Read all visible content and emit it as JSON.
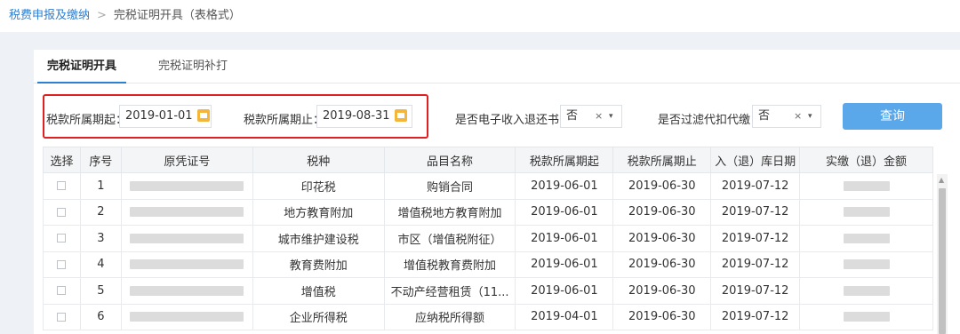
{
  "breadcrumb": {
    "parent": "税费申报及缴纳",
    "separator": ">",
    "current": "完税证明开具（表格式）"
  },
  "tabs": [
    {
      "label": "完税证明开具",
      "active": true
    },
    {
      "label": "完税证明补打",
      "active": false
    }
  ],
  "filters": {
    "start_label": "税款所属期起：",
    "start_value": "2019-01-01",
    "end_label": "税款所属期止：",
    "end_value": "2019-08-31",
    "refund_label": "是否电子收入退还书：",
    "refund_value": "否",
    "withhold_label": "是否过滤代扣代缴：",
    "withhold_value": "否",
    "clear_icon": "×",
    "caret_icon": "▾"
  },
  "query_button": "查询",
  "table": {
    "headers": [
      "选择",
      "序号",
      "原凭证号",
      "税种",
      "品目名称",
      "税款所属期起",
      "税款所属期止",
      "入（退）库日期",
      "实缴（退）金额"
    ],
    "rows": [
      {
        "no": "1",
        "tax": "印花税",
        "item": "购销合同",
        "start": "2019-06-01",
        "end": "2019-06-30",
        "date": "2019-07-12"
      },
      {
        "no": "2",
        "tax": "地方教育附加",
        "item": "增值税地方教育附加",
        "start": "2019-06-01",
        "end": "2019-06-30",
        "date": "2019-07-12"
      },
      {
        "no": "3",
        "tax": "城市维护建设税",
        "item": "市区（增值税附征）",
        "start": "2019-06-01",
        "end": "2019-06-30",
        "date": "2019-07-12"
      },
      {
        "no": "4",
        "tax": "教育费附加",
        "item": "增值税教育费附加",
        "start": "2019-06-01",
        "end": "2019-06-30",
        "date": "2019-07-12"
      },
      {
        "no": "5",
        "tax": "增值税",
        "item": "不动产经营租赁（11...",
        "start": "2019-06-01",
        "end": "2019-06-30",
        "date": "2019-07-12"
      },
      {
        "no": "6",
        "tax": "企业所得税",
        "item": "应纳税所得额",
        "start": "2019-04-01",
        "end": "2019-06-30",
        "date": "2019-07-12"
      }
    ]
  },
  "colors": {
    "accent": "#2d7fd1",
    "button": "#5aa7ea",
    "highlight_border": "#e02020",
    "calendar_icon": "#f3b63a"
  }
}
